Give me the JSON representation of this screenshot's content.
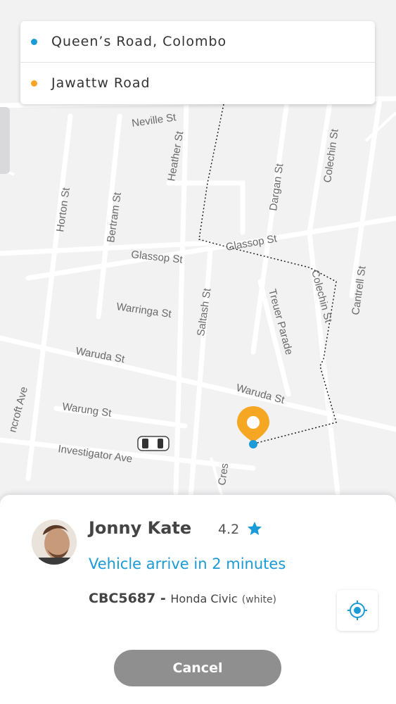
{
  "route": {
    "pickup": "Queen’s Road, Colombo",
    "dropoff": "Jawattw Road",
    "pickup_color": "#1a9bd7",
    "dropoff_color": "#f5a623"
  },
  "map": {
    "streets": [
      "Neville St",
      "Heather St",
      "Horton St",
      "Bertram St",
      "Dargan St",
      "Colechin St",
      "Glassop St",
      "Glassop St",
      "Cantrell St",
      "Colechin St",
      "Treuer Parade",
      "Warringa St",
      "Saltash St",
      "Waruda St",
      "Waruda St",
      "Warung St",
      "Investigator Ave",
      "ncroft Ave",
      "Cres"
    ],
    "pin_color": "#f5a623",
    "route_dot_color": "#1a9bd7"
  },
  "driver": {
    "name": "Jonny Kate",
    "rating": "4.2",
    "arrival": "Vehicle arrive in 2 minutes",
    "plate": "CBC5687",
    "separator": " - ",
    "model": "Honda Civic",
    "color": "(white)",
    "accent": "#1a9bd7"
  },
  "actions": {
    "cancel_label": "Cancel",
    "locate_icon": "crosshair-icon"
  }
}
